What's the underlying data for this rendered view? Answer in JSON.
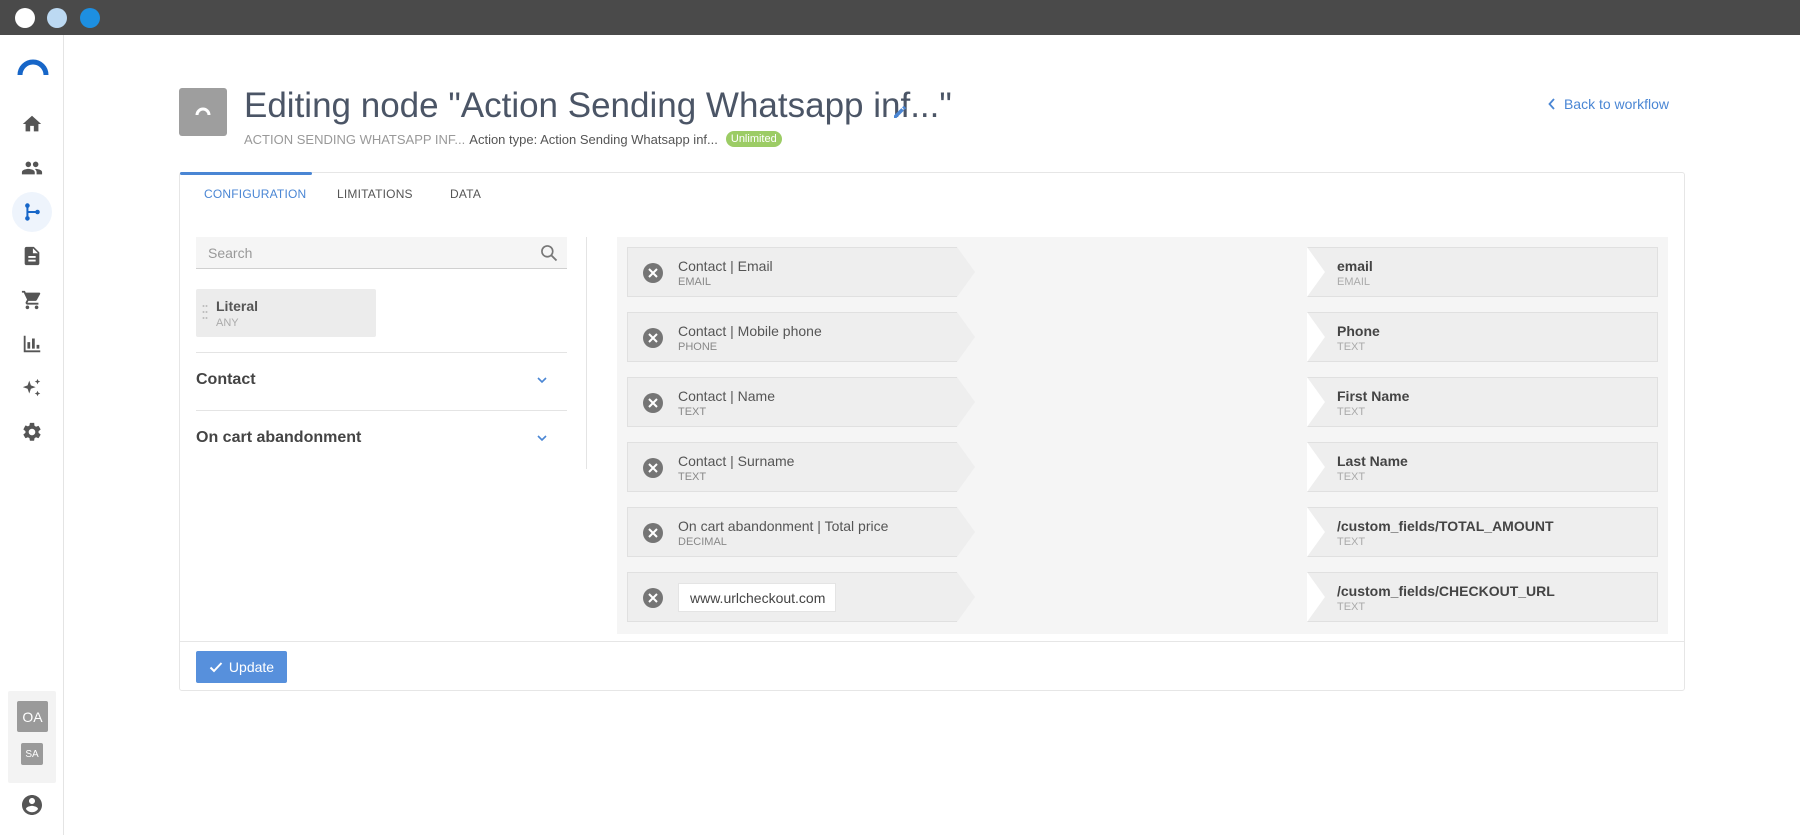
{
  "window": {
    "controls": [
      "close",
      "minimize",
      "maximize"
    ]
  },
  "sidebar": {
    "items": [
      {
        "name": "home",
        "icon": "home-icon"
      },
      {
        "name": "contacts",
        "icon": "people-icon"
      },
      {
        "name": "workflows",
        "icon": "workflow-icon",
        "active": true
      },
      {
        "name": "documents",
        "icon": "document-icon"
      },
      {
        "name": "commerce",
        "icon": "cart-icon"
      },
      {
        "name": "analytics",
        "icon": "bar-chart-icon"
      },
      {
        "name": "ai",
        "icon": "sparkle-icon"
      },
      {
        "name": "settings",
        "icon": "gear-icon"
      }
    ],
    "avatar_primary": "OA",
    "avatar_secondary": "SA"
  },
  "header": {
    "title": "Editing node \"Action Sending Whatsapp inf...\"",
    "node_name": "ACTION SENDING WHATSAPP INF...",
    "action_type": "Action type: Action Sending Whatsapp inf...",
    "badge": "Unlimited",
    "back_link": "Back to workflow"
  },
  "tabs": [
    {
      "label": "CONFIGURATION",
      "active": true
    },
    {
      "label": "LIMITATIONS",
      "active": false
    },
    {
      "label": "DATA",
      "active": false
    }
  ],
  "fields_panel": {
    "search_placeholder": "Search",
    "literal": {
      "title": "Literal",
      "type": "ANY"
    },
    "groups": [
      {
        "label": "Contact"
      },
      {
        "label": "On cart abandonment"
      }
    ]
  },
  "mappings": [
    {
      "source": "Contact | Email",
      "source_type": "EMAIL",
      "action": "Assign",
      "target": "email",
      "target_type": "EMAIL"
    },
    {
      "source": "Contact | Mobile phone",
      "source_type": "PHONE",
      "action": "Assign",
      "target": "Phone",
      "target_type": "TEXT"
    },
    {
      "source": "Contact | Name",
      "source_type": "TEXT",
      "action": "Assign",
      "target": "First Name",
      "target_type": "TEXT"
    },
    {
      "source": "Contact | Surname",
      "source_type": "TEXT",
      "action": "Assign",
      "target": "Last Name",
      "target_type": "TEXT"
    },
    {
      "source": "On cart abandonment | Total price",
      "source_type": "DECIMAL",
      "action": "Assign",
      "target": "/custom_fields/TOTAL_AMOUNT",
      "target_type": "TEXT"
    },
    {
      "literal_value": "www.urlcheckout.com",
      "action": "Assign",
      "target": "/custom_fields/CHECKOUT_URL",
      "target_type": "TEXT"
    }
  ],
  "footer": {
    "update_label": "Update"
  },
  "colors": {
    "accent": "#4a86d4",
    "badge": "#9ccc65",
    "button": "#5790dc"
  }
}
